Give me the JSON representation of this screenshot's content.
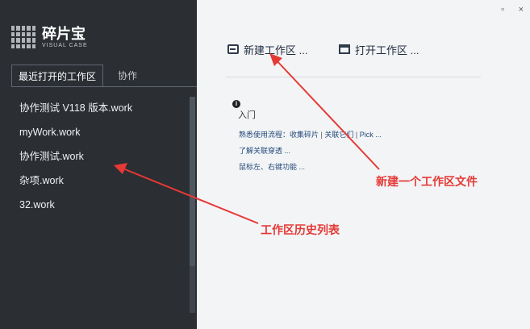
{
  "app": {
    "name": "碎片宝",
    "subtitle": "VISUAL CASE"
  },
  "tabs": [
    {
      "label": "最近打开的工作区"
    },
    {
      "label": "协作"
    }
  ],
  "recent_files": [
    {
      "label": "协作测试 V118 版本.work"
    },
    {
      "label": "myWork.work"
    },
    {
      "label": "协作测试.work"
    },
    {
      "label": "杂项.work"
    },
    {
      "label": "32.work"
    }
  ],
  "window": {
    "minimize_label": "▫",
    "close_label": "×"
  },
  "actions": {
    "new_label": "新建工作区 ...",
    "open_label": "打开工作区 ..."
  },
  "get_started": {
    "title": "入门",
    "links": [
      "熟悉使用流程：收集碎片",
      "关联它们",
      "Pick ...",
      "了解关联穿透 ...",
      "鼠标左、右键功能 ..."
    ],
    "separator": "|"
  },
  "annotations": {
    "new_workspace_file": "新建一个工作区文件",
    "history_list": "工作区历史列表"
  },
  "colors": {
    "sidebar_bg": "#2b2e33",
    "main_bg": "#f3f4f6",
    "annotation": "#e53935",
    "link": "#244a7a"
  }
}
